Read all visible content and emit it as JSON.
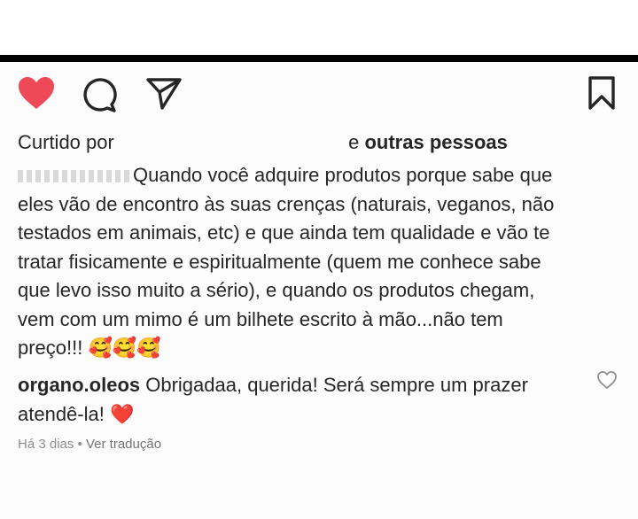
{
  "colors": {
    "liked_heart": "#ed4956",
    "text": "#262626",
    "meta": "#8e8e8e",
    "bar": "#000000"
  },
  "actions": {
    "like_icon": "heart-filled-icon",
    "comment_icon": "comment-bubble-icon",
    "share_icon": "send-paper-plane-icon",
    "save_icon": "bookmark-icon"
  },
  "likes": {
    "prefix": "Curtido por",
    "joiner": "e",
    "others": "outras pessoas"
  },
  "caption": {
    "text": "Quando você adquire produtos porque sabe que\neles vão de encontro às suas crenças (naturais, veganos, não\ntestados em animais, etc) e que ainda tem qualidade e vão te\ntratar fisicamente e espiritualmente (quem me conhece sabe\nque levo isso muito a sério), e quando os produtos chegam,\nvem com um mimo é um bilhete escrito à mão...não tem\npreço!!! ",
    "emojis": "🥰🥰🥰"
  },
  "reply": {
    "author": "organo.oleos",
    "text": "Obrigadaa, querida! Será sempre um prazer atendê-la!",
    "emoji": "❤️"
  },
  "meta": {
    "time": "Há 3 dias",
    "separator": "•",
    "translate": "Ver tradução"
  }
}
